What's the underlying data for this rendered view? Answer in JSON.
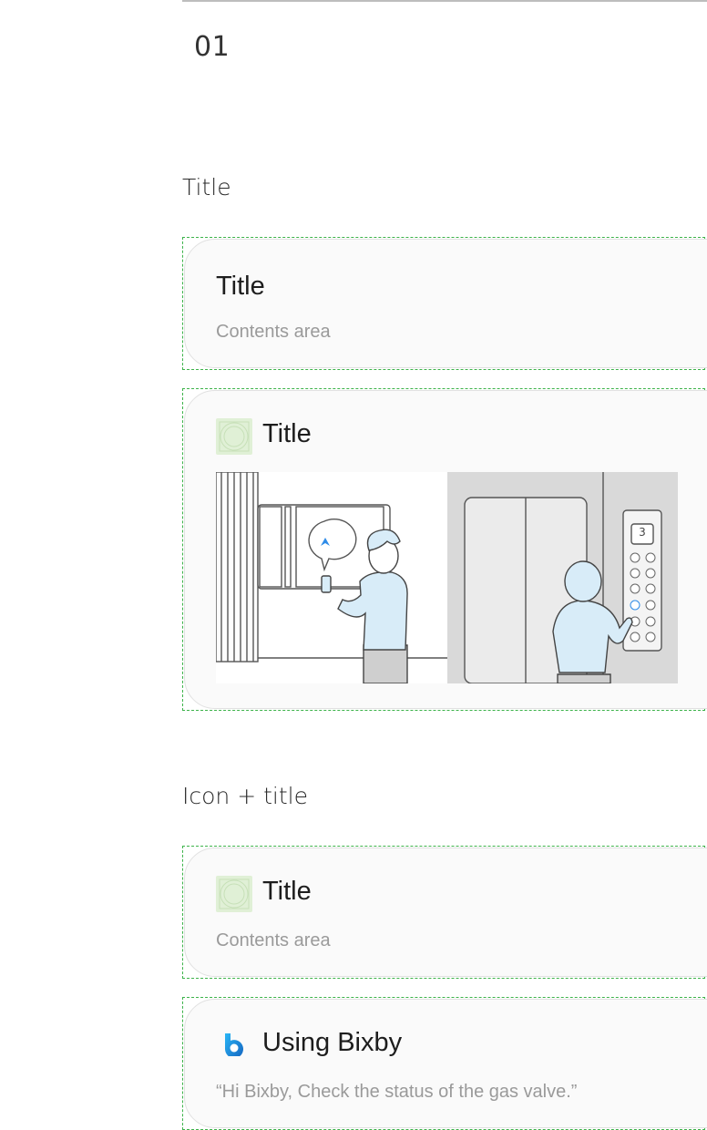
{
  "section": {
    "number": "01"
  },
  "headings": {
    "title": "Title",
    "icon_title": "Icon + title"
  },
  "card1": {
    "title": "Title",
    "contents": "Contents area"
  },
  "card2": {
    "title": "Title",
    "icon": "thumbnail-placeholder-icon",
    "illustration": {
      "floor": "3"
    }
  },
  "card3": {
    "title": "Title",
    "contents": "Contents area",
    "icon": "thumbnail-placeholder-icon"
  },
  "card4": {
    "title": "Using Bixby",
    "contents": "“Hi Bixby, Check the status of the gas valve.”",
    "icon": "bixby-icon"
  },
  "colors": {
    "guide": "#3db34a",
    "card_bg": "#fafafa",
    "icon_bg": "#e0f0d6",
    "bixby": "#1f7fe0"
  }
}
